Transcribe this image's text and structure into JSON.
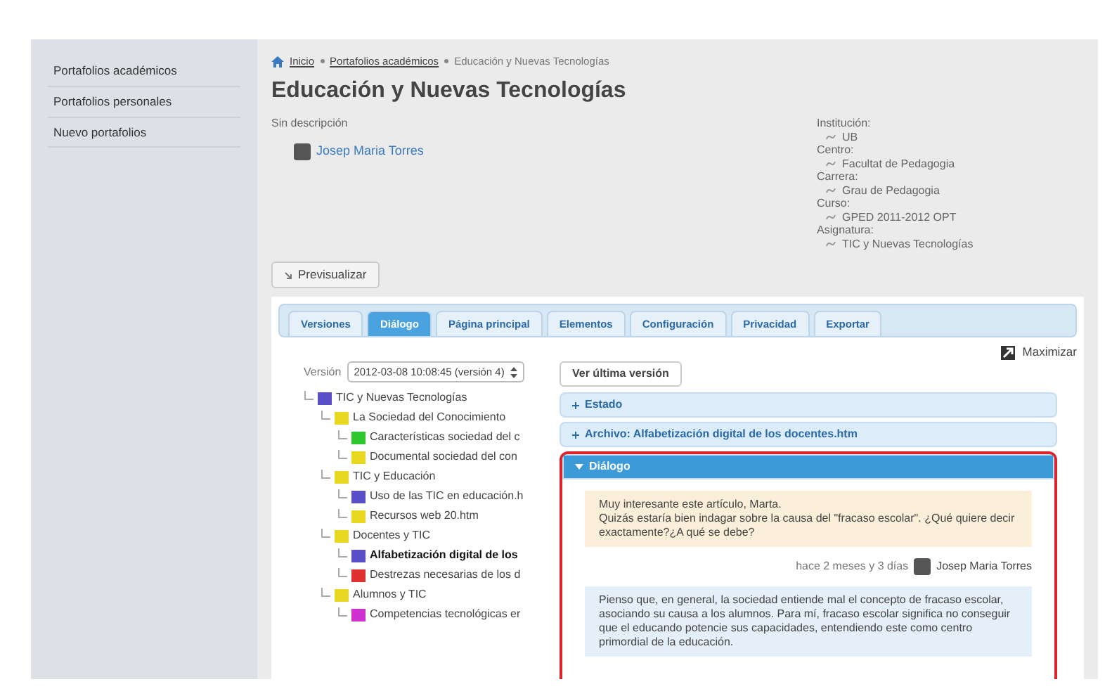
{
  "sidebar": {
    "items": [
      {
        "label": "Portafolios académicos"
      },
      {
        "label": "Portafolios personales"
      },
      {
        "label": "Nuevo portafolios"
      }
    ]
  },
  "breadcrumb": [
    {
      "label": "Inicio",
      "kind": "link"
    },
    {
      "label": "Portafolios académicos",
      "kind": "link"
    },
    {
      "label": "Educación y Nuevas Tecnologías",
      "kind": "text"
    }
  ],
  "title": "Educación y Nuevas Tecnologías",
  "description": "Sin descripción",
  "owner": "Josep Maria Torres",
  "details": [
    {
      "label": "Institución:",
      "value": "UB"
    },
    {
      "label": "Centro:",
      "value": "Facultat de Pedagogia"
    },
    {
      "label": "Carrera:",
      "value": "Grau de Pedagogia"
    },
    {
      "label": "Curso:",
      "value": "GPED 2011-2012 OPT"
    },
    {
      "label": "Asignatura:",
      "value": "TIC y Nuevas Tecnologías"
    }
  ],
  "preview_button": "Previsualizar",
  "tabs": [
    {
      "label": "Versiones",
      "selected": false
    },
    {
      "label": "Diálogo",
      "selected": true
    },
    {
      "label": "Página principal",
      "selected": false
    },
    {
      "label": "Elementos",
      "selected": false
    },
    {
      "label": "Configuración",
      "selected": false
    },
    {
      "label": "Privacidad",
      "selected": false
    },
    {
      "label": "Exportar",
      "selected": false
    }
  ],
  "maximize": "Maximizar",
  "version": {
    "label": "Versión",
    "value": "2012-03-08 10:08:45 (versión 4)",
    "button": "Ver última versión"
  },
  "tree": [
    {
      "label": "TIC y Nuevas Tecnologías",
      "color": "#5a4fc8",
      "selected": false,
      "children": [
        {
          "label": "La Sociedad del Conocimiento",
          "color": "#e8d820",
          "selected": false,
          "children": [
            {
              "label": "Características sociedad del c",
              "color": "#2ec82e",
              "selected": false
            },
            {
              "label": "Documental sociedad del con",
              "color": "#e8d820",
              "selected": false
            }
          ]
        },
        {
          "label": "TIC y Educación",
          "color": "#e8d820",
          "selected": false,
          "children": [
            {
              "label": "Uso de las TIC en educación.h",
              "color": "#5a4fc8",
              "selected": false
            },
            {
              "label": "Recursos web 20.htm",
              "color": "#e8d820",
              "selected": false
            }
          ]
        },
        {
          "label": "Docentes y TIC",
          "color": "#e8d820",
          "selected": false,
          "children": [
            {
              "label": "Alfabetización digital de los",
              "color": "#5a4fc8",
              "selected": true
            },
            {
              "label": "Destrezas necesarias de los d",
              "color": "#e03030",
              "selected": false
            }
          ]
        },
        {
          "label": "Alumnos y TIC",
          "color": "#e8d820",
          "selected": false,
          "children": [
            {
              "label": "Competencias tecnológicas er",
              "color": "#d030d0",
              "selected": false
            }
          ]
        }
      ]
    }
  ],
  "sections": [
    {
      "label": "Estado",
      "expanded": false
    },
    {
      "label": "Archivo: Alfabetización digital de los docentes.htm",
      "expanded": false
    },
    {
      "label": "Diálogo",
      "expanded": true
    }
  ],
  "messages": [
    {
      "kind": "comment",
      "text": "Muy interesante este artículo, Marta.\nQuizás estaría bien indagar sobre la causa del \"fracaso escolar\". ¿Qué quiere decir exactamente?¿A qué se debe?",
      "time": "hace 2 meses y 3 días",
      "author": "Josep Maria Torres"
    },
    {
      "kind": "reply",
      "text": "Pienso que, en general, la sociedad entiende mal el concepto de fracaso escolar, asociando su causa a los alumnos. Para mí, fracaso escolar significa no conseguir que el educando potencie sus capacidades, entendiendo este como centro primordial de la educación."
    }
  ]
}
